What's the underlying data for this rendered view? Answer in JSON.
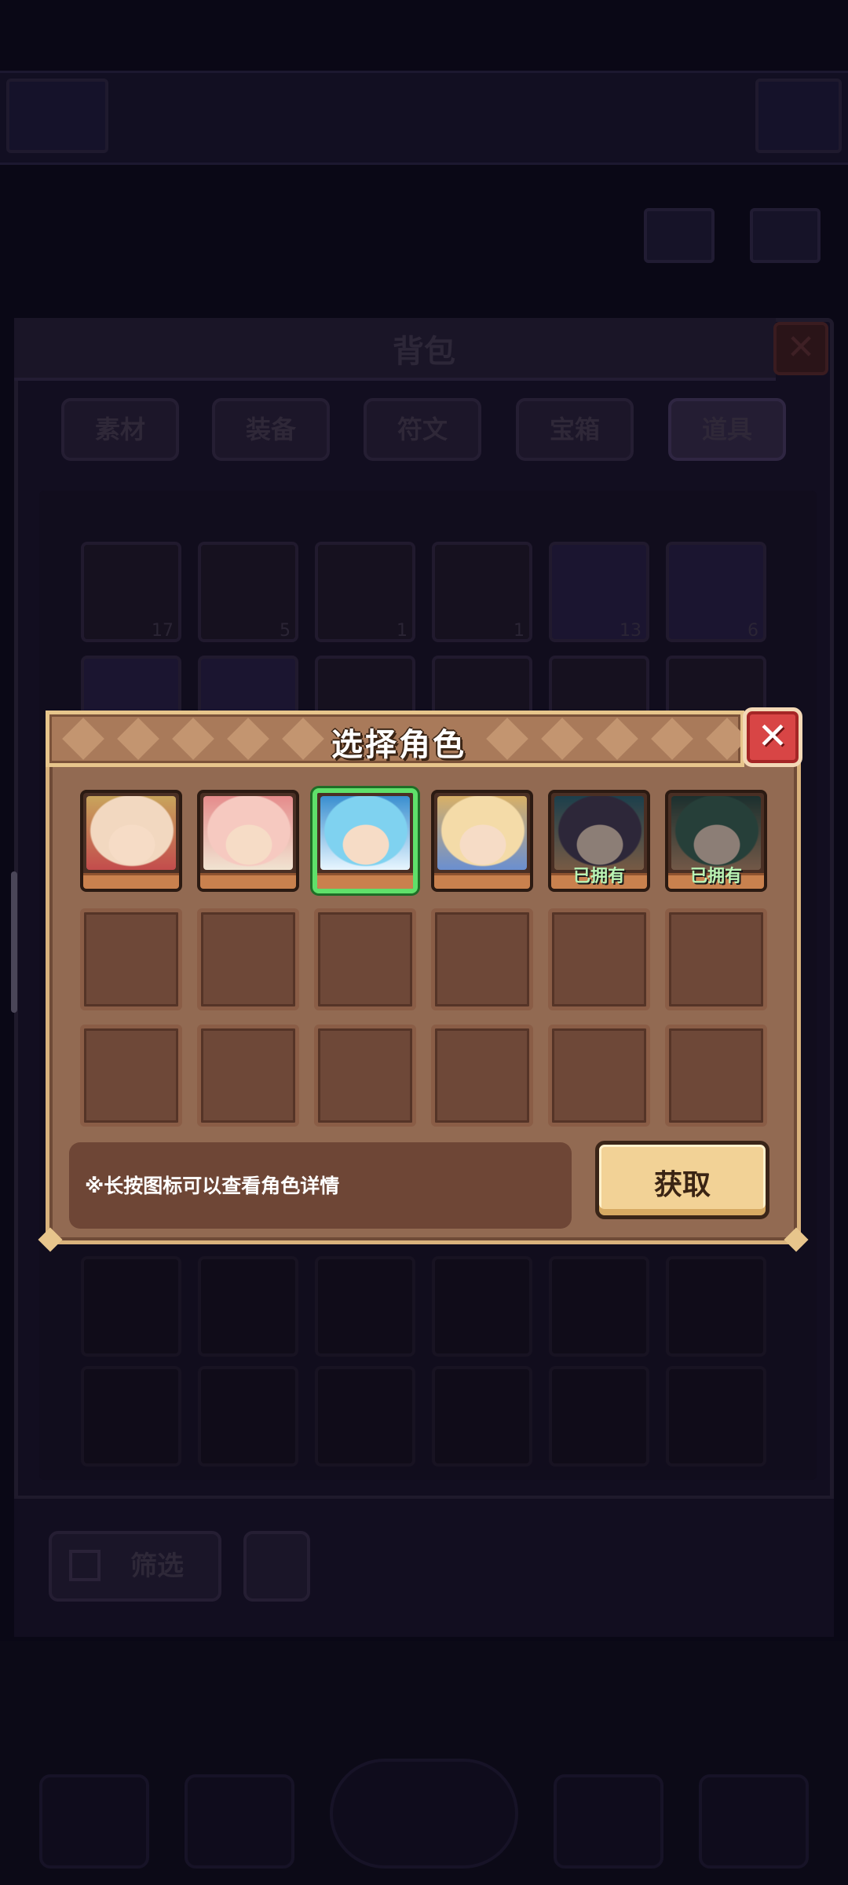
{
  "background": {
    "bag_title": "背包",
    "tabs": [
      "素材",
      "装备",
      "符文",
      "宝箱",
      "道具"
    ],
    "active_tab": "道具",
    "item_counts": [
      "17",
      "5",
      "1",
      "1",
      "13",
      "6"
    ],
    "filter_label": "筛选"
  },
  "modal": {
    "title": "选择角色",
    "characters": [
      {
        "owned": false,
        "selected": false,
        "palette": [
          "#f2d8c0",
          "#c8a45c",
          "#c34c4c"
        ]
      },
      {
        "owned": false,
        "selected": false,
        "palette": [
          "#f6c9c0",
          "#e58c8c",
          "#f1e3d1"
        ]
      },
      {
        "owned": false,
        "selected": true,
        "palette": [
          "#7fd2f0",
          "#3a8fd0",
          "#e8f6ff"
        ]
      },
      {
        "owned": false,
        "selected": false,
        "palette": [
          "#f4dba8",
          "#d8b067",
          "#6a8fd0"
        ]
      },
      {
        "owned": true,
        "selected": false,
        "palette": [
          "#4a3f58",
          "#2b6a7a",
          "#d09c6c"
        ]
      },
      {
        "owned": true,
        "selected": false,
        "palette": [
          "#3d6a58",
          "#2a4f45",
          "#c79872"
        ]
      }
    ],
    "owned_label": "已拥有",
    "hint": "※长按图标可以查看角色详情",
    "get_button": "获取",
    "close_glyph": "✕"
  }
}
